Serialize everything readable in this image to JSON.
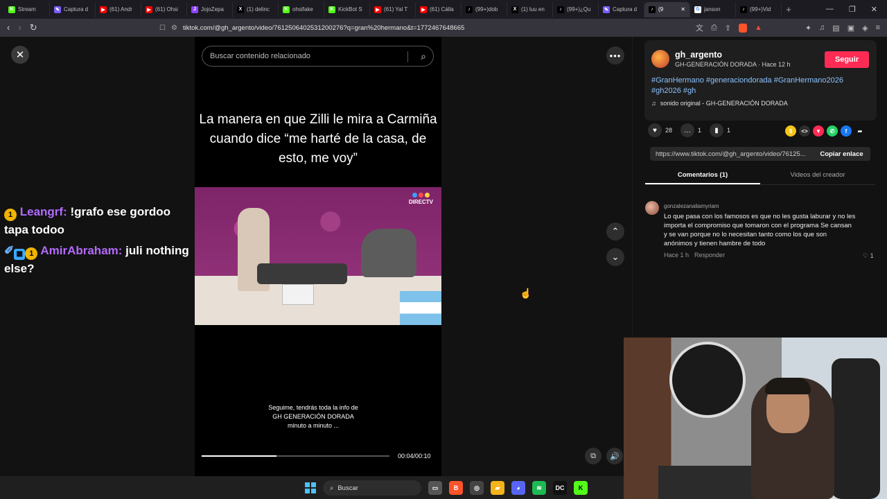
{
  "browser": {
    "tabs": [
      {
        "label": "Stream",
        "color": "#53fc18",
        "glyph": "K"
      },
      {
        "label": "Captura d",
        "color": "#7c5cff",
        "glyph": "✎"
      },
      {
        "label": "(61) Andr",
        "color": "#ff0000",
        "glyph": "▶"
      },
      {
        "label": "(61) Ohsi",
        "color": "#ff0000",
        "glyph": "▶"
      },
      {
        "label": "JojoZepa",
        "color": "#8e44ff",
        "glyph": "J"
      },
      {
        "label": "(1) delinc",
        "color": "#000000",
        "glyph": "X"
      },
      {
        "label": "ohsifake",
        "color": "#53fc18",
        "glyph": "K"
      },
      {
        "label": "KickBot S",
        "color": "#53fc18",
        "glyph": "K"
      },
      {
        "label": "(61) Yal T",
        "color": "#ff0000",
        "glyph": "▶"
      },
      {
        "label": "(61) Cálla",
        "color": "#ff0000",
        "glyph": "▶"
      },
      {
        "label": "(99+)dob",
        "color": "#000000",
        "glyph": "♪"
      },
      {
        "label": "(1) luu en",
        "color": "#000000",
        "glyph": "X"
      },
      {
        "label": "(99+)¿Qu",
        "color": "#000000",
        "glyph": "♪"
      },
      {
        "label": "Captura d",
        "color": "#7c5cff",
        "glyph": "✎"
      },
      {
        "label": "(9",
        "color": "#000000",
        "glyph": "♪",
        "active": true
      },
      {
        "label": "janson",
        "color": "#ffffff",
        "glyph": "G"
      },
      {
        "label": "(99+)Vid",
        "color": "#000000",
        "glyph": "♪"
      }
    ],
    "url": "tiktok.com/@gh_argento/video/7612506402531200276?q=gran%20hermano&t=1772467648665"
  },
  "video": {
    "search_placeholder": "Buscar contenido relacionado",
    "caption": "La manera en que Zilli le mira a Carmiña cuando dice “me harté de la casa, de esto, me voy”",
    "broadcaster_logo": "DIRECTV",
    "subtitle_line1": "Seguime, tendrás toda la info de",
    "subtitle_line2": "GH GENERACIÓN DORADA",
    "subtitle_line3": "minuto a minuto ...",
    "timecode": "00:04/00:10",
    "progress_fraction": 0.4
  },
  "chat": [
    {
      "user": "Leangrf:",
      "text": " !grafo ese gordoo tapa todoo"
    },
    {
      "user": "AmirAbraham:",
      "text": " juli nothing else?"
    }
  ],
  "panel": {
    "username": "gh_argento",
    "meta": "GH-GENERACIÓN DORADA · Hace 12 h",
    "follow_label": "Seguir",
    "hashtags": "#GranHermano #generaciondorada #GranHermano2026 #gh2026 #gh",
    "sound": "sonido original - GH-GENERACIÓN DORADA",
    "likes": "28",
    "comments": "1",
    "saves": "1",
    "link": "https://www.tiktok.com/@gh_argento/video/76125...",
    "copy_label": "Copiar enlace",
    "tab_comments": "Comentarios (1)",
    "tab_creator": "Videos del creador",
    "comment": {
      "user": "gonzalezanaliamyriam",
      "text": "Lo que pasa con los famosos es que no les gusta laburar y no les importa el compromiso que tomaron con el programa Se cansan y se van porque no lo necesitan tanto como los que son anónimos y tienen hambre de todo",
      "time": "Hace 1 h",
      "reply": "Responder",
      "likes": "1"
    }
  },
  "taskbar": {
    "search_label": "Buscar"
  },
  "colors": {
    "follow": "#fe2c55",
    "hashtag": "#8cc4ff",
    "chat_user": "#b36bff"
  }
}
